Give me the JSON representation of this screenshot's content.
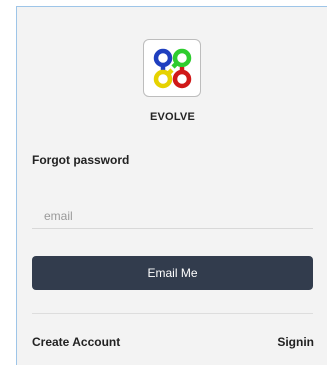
{
  "brand": {
    "name": "EVOLVE",
    "logo_icon": "evolve-logo-icon",
    "logo_colors": [
      "#1f3fbf",
      "#2ecc2e",
      "#e6d200",
      "#d01818"
    ]
  },
  "form": {
    "heading": "Forgot password",
    "email_placeholder": "email",
    "email_value": "",
    "submit_label": "Email Me"
  },
  "footer": {
    "create_account_label": "Create Account",
    "signin_label": "Signin"
  },
  "colors": {
    "button_bg": "#323c4d",
    "card_bg": "#f3f3f3"
  }
}
